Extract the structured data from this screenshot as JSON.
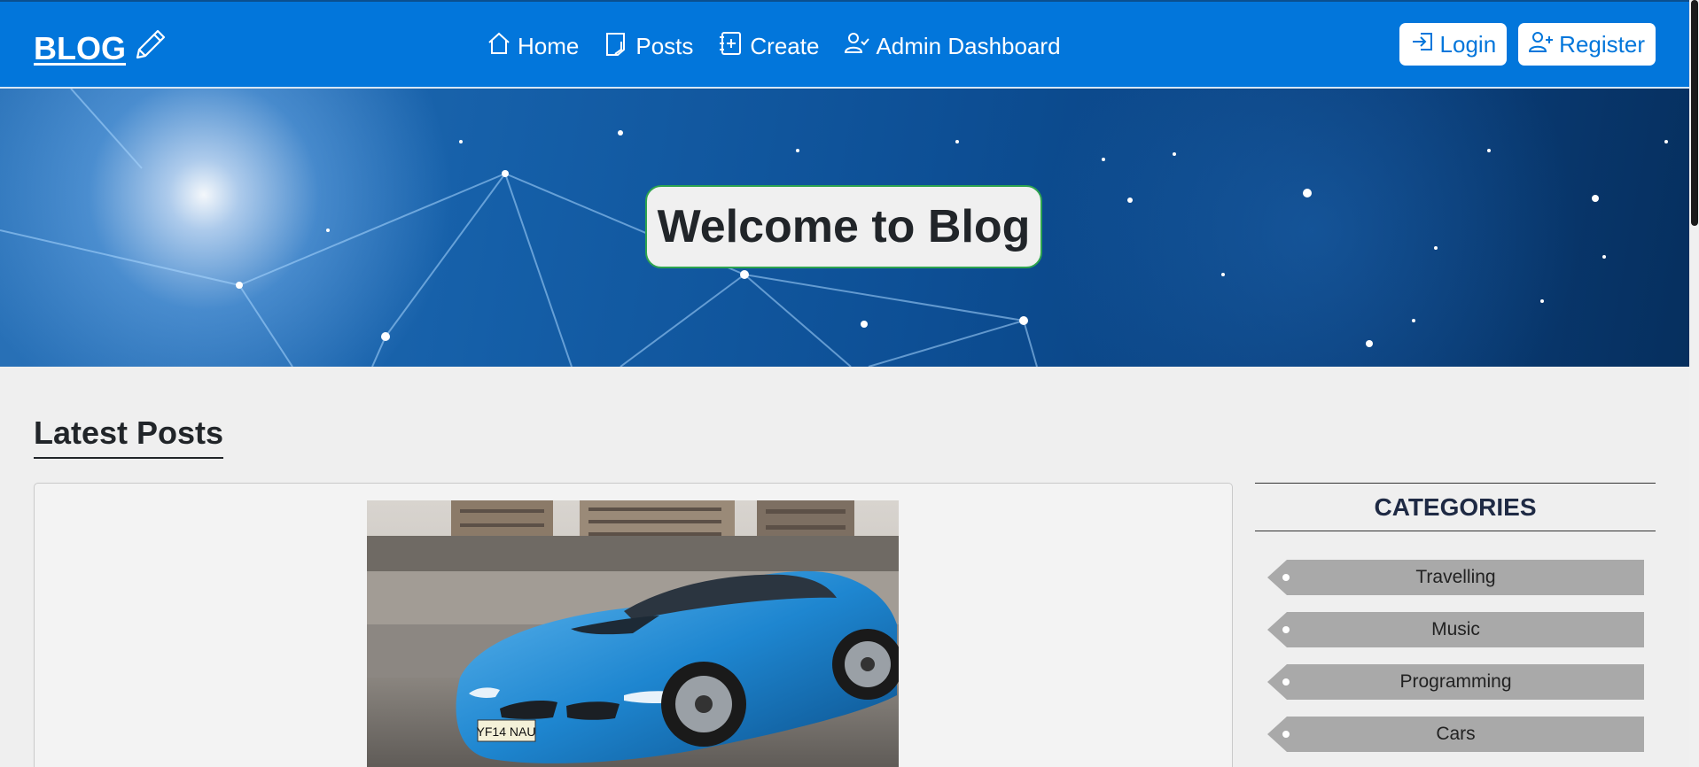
{
  "navbar": {
    "brand": "BLOG",
    "brand_icon": "pencil-icon",
    "links": [
      {
        "label": "Home",
        "icon": "house-icon"
      },
      {
        "label": "Posts",
        "icon": "sticky-note-icon"
      },
      {
        "label": "Create",
        "icon": "journal-plus-icon"
      },
      {
        "label": "Admin Dashboard",
        "icon": "person-check-icon"
      }
    ],
    "login_label": "Login",
    "register_label": "Register",
    "accent": "#0276db"
  },
  "hero": {
    "title": "Welcome to Blog"
  },
  "main": {
    "section_title": "Latest Posts"
  },
  "sidebar": {
    "header": "CATEGORIES",
    "categories": [
      "Travelling",
      "Music",
      "Programming",
      "Cars"
    ]
  }
}
